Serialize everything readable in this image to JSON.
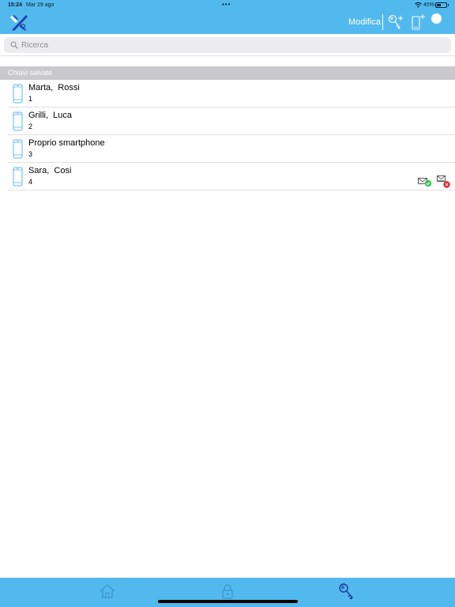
{
  "statusbar": {
    "time": "15:24",
    "date": "Mar 29 ago",
    "dots": "•••",
    "battery_text": "45%",
    "battery_level": 0.45
  },
  "navbar": {
    "edit_label": "Modifica",
    "icons": [
      "app-logo-icon",
      "add-key-icon",
      "add-phone-icon",
      "profile-circle-icon"
    ]
  },
  "search": {
    "placeholder": "Ricerca",
    "value": ""
  },
  "section": {
    "title": "Chiavi salvate"
  },
  "keys": [
    {
      "name": "Marta,  Rossi",
      "number": "1",
      "badges": []
    },
    {
      "name": "Grilli,  Luca",
      "number": "2",
      "badges": []
    },
    {
      "name": "Proprio smartphone",
      "number": "3",
      "badges": []
    },
    {
      "name": "Sara,  Cosi",
      "number": "4",
      "badges": [
        "mail-sent-ok-icon",
        "mail-failed-icon"
      ]
    }
  ],
  "tabbar": {
    "tabs": [
      "home-icon",
      "lock-icon",
      "keys-icon"
    ],
    "active": "keys-icon"
  },
  "colors": {
    "brand": "#52b9ee",
    "section_header": "#c8c8cd",
    "success": "#34c759",
    "error": "#e0202a",
    "phone_icon": "#5bb8ea"
  }
}
